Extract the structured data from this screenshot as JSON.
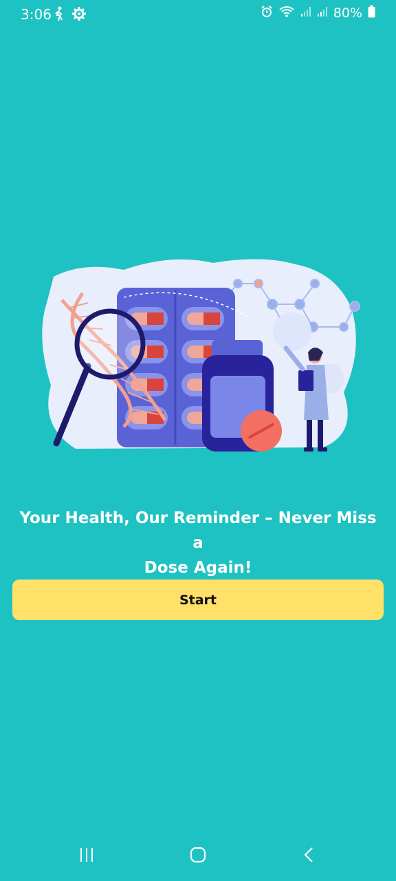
{
  "status_bar": {
    "time": "3:06",
    "battery_percent": "80%",
    "icons": [
      "walking-icon",
      "gear-icon",
      "alarm-icon",
      "wifi-icon",
      "signal-icon",
      "signal-icon",
      "battery-icon"
    ]
  },
  "hero": {
    "illustration": "medicine-illustration",
    "colors": {
      "blob": "#e8eefb",
      "pill_pack": "#5a63d6",
      "capsule": "#f0a79a",
      "dna": "#f3a08f",
      "bottle": "#28239a",
      "tablet": "#f26f61"
    }
  },
  "onboarding": {
    "headline_line1": "Your Health, Our Reminder – Never Miss a",
    "headline_line2": "Dose Again!",
    "start_label": "Start"
  },
  "colors": {
    "background": "#1ec2c2",
    "button": "#ffe069"
  },
  "nav_bar": {
    "buttons": [
      "recent-apps-icon",
      "home-icon",
      "back-icon"
    ]
  }
}
